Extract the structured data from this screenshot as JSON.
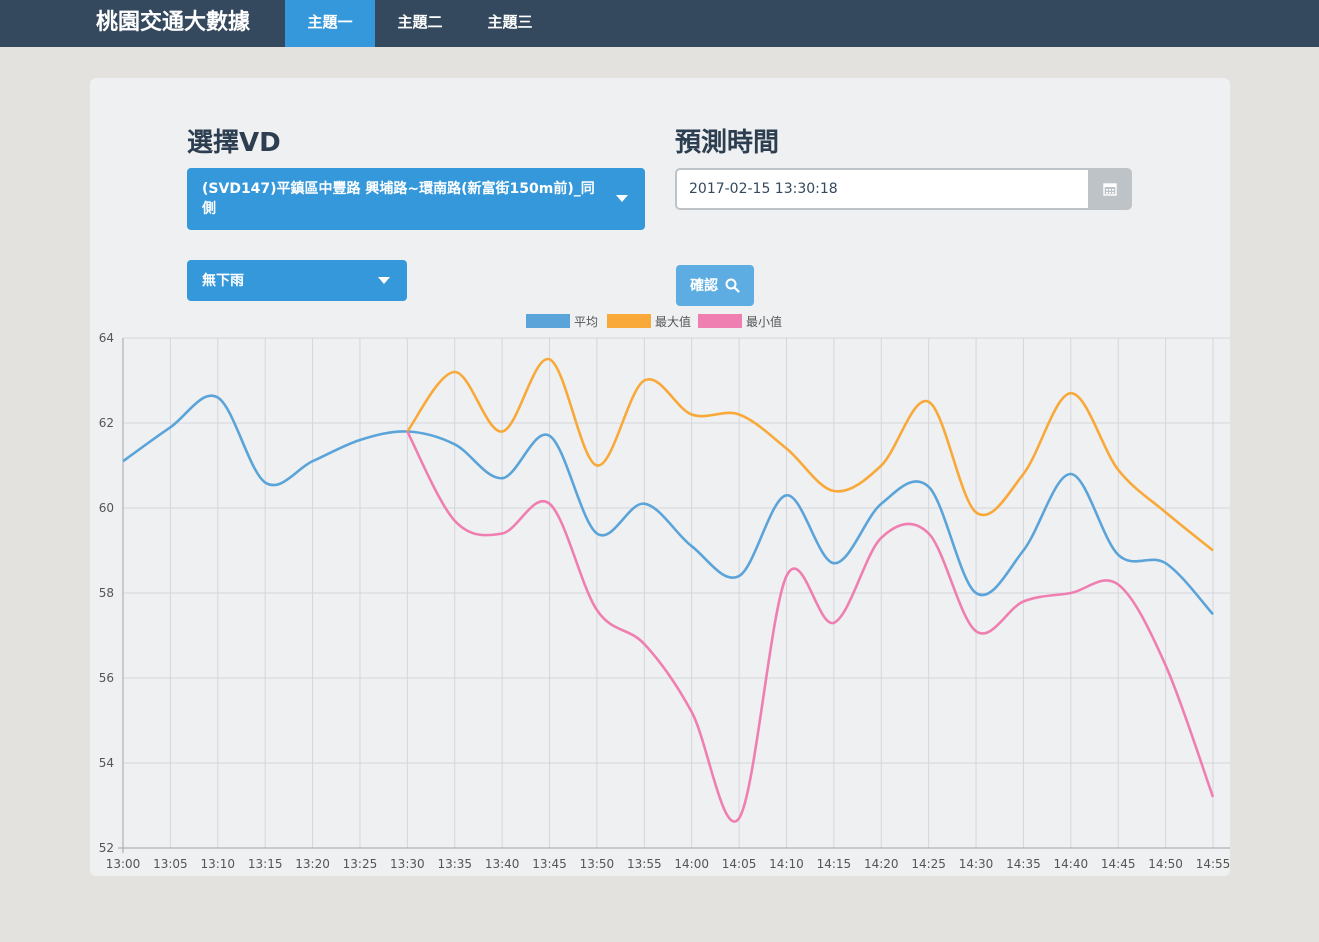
{
  "app": {
    "brand": "桃園交通大數據",
    "tabs": [
      {
        "label": "主題一",
        "active": true
      },
      {
        "label": "主題二",
        "active": false
      },
      {
        "label": "主題三",
        "active": false
      }
    ]
  },
  "form": {
    "vd_heading": "選擇VD",
    "vd_selected": "(SVD147)平鎮區中豐路 興埔路~環南路(新富街150m前)_同側",
    "rain_selected": "無下雨",
    "time_heading": "預測時間",
    "time_value": "2017-02-15 13:30:18",
    "confirm_label": "確認"
  },
  "colors": {
    "accent": "#3498db",
    "navbar": "#34495e",
    "avg": "#5ba4d9",
    "max": "#f8a939",
    "min": "#ef7fb1"
  },
  "chart_data": {
    "type": "line",
    "x": [
      "13:00",
      "13:05",
      "13:10",
      "13:15",
      "13:20",
      "13:25",
      "13:30",
      "13:35",
      "13:40",
      "13:45",
      "13:50",
      "13:55",
      "14:00",
      "14:05",
      "14:10",
      "14:15",
      "14:20",
      "14:25",
      "14:30",
      "14:35",
      "14:40",
      "14:45",
      "14:50",
      "14:55"
    ],
    "ylim": [
      52,
      64
    ],
    "yticks": [
      52,
      54,
      56,
      58,
      60,
      62,
      64
    ],
    "grid": true,
    "legend_position": "top-center",
    "series": [
      {
        "name": "平均",
        "color": "#5ba4d9",
        "values": [
          61.1,
          61.9,
          62.6,
          60.6,
          61.1,
          61.6,
          61.8,
          61.5,
          60.7,
          61.7,
          59.4,
          60.1,
          59.1,
          58.4,
          60.3,
          58.7,
          60.1,
          60.5,
          58.0,
          59.0,
          60.8,
          58.9,
          58.7,
          57.5
        ]
      },
      {
        "name": "最大值",
        "color": "#f8a939",
        "values": [
          null,
          null,
          null,
          null,
          null,
          null,
          61.8,
          63.2,
          61.8,
          63.5,
          61.0,
          63.0,
          62.2,
          62.2,
          61.4,
          60.4,
          61.0,
          62.5,
          59.9,
          60.8,
          62.7,
          60.9,
          59.9,
          59.0
        ]
      },
      {
        "name": "最小值",
        "color": "#ef7fb1",
        "values": [
          null,
          null,
          null,
          null,
          null,
          null,
          61.8,
          59.7,
          59.4,
          60.1,
          57.6,
          56.8,
          55.2,
          52.7,
          58.4,
          57.3,
          59.3,
          59.4,
          57.1,
          57.8,
          58.0,
          58.2,
          56.3,
          53.2
        ]
      }
    ]
  }
}
